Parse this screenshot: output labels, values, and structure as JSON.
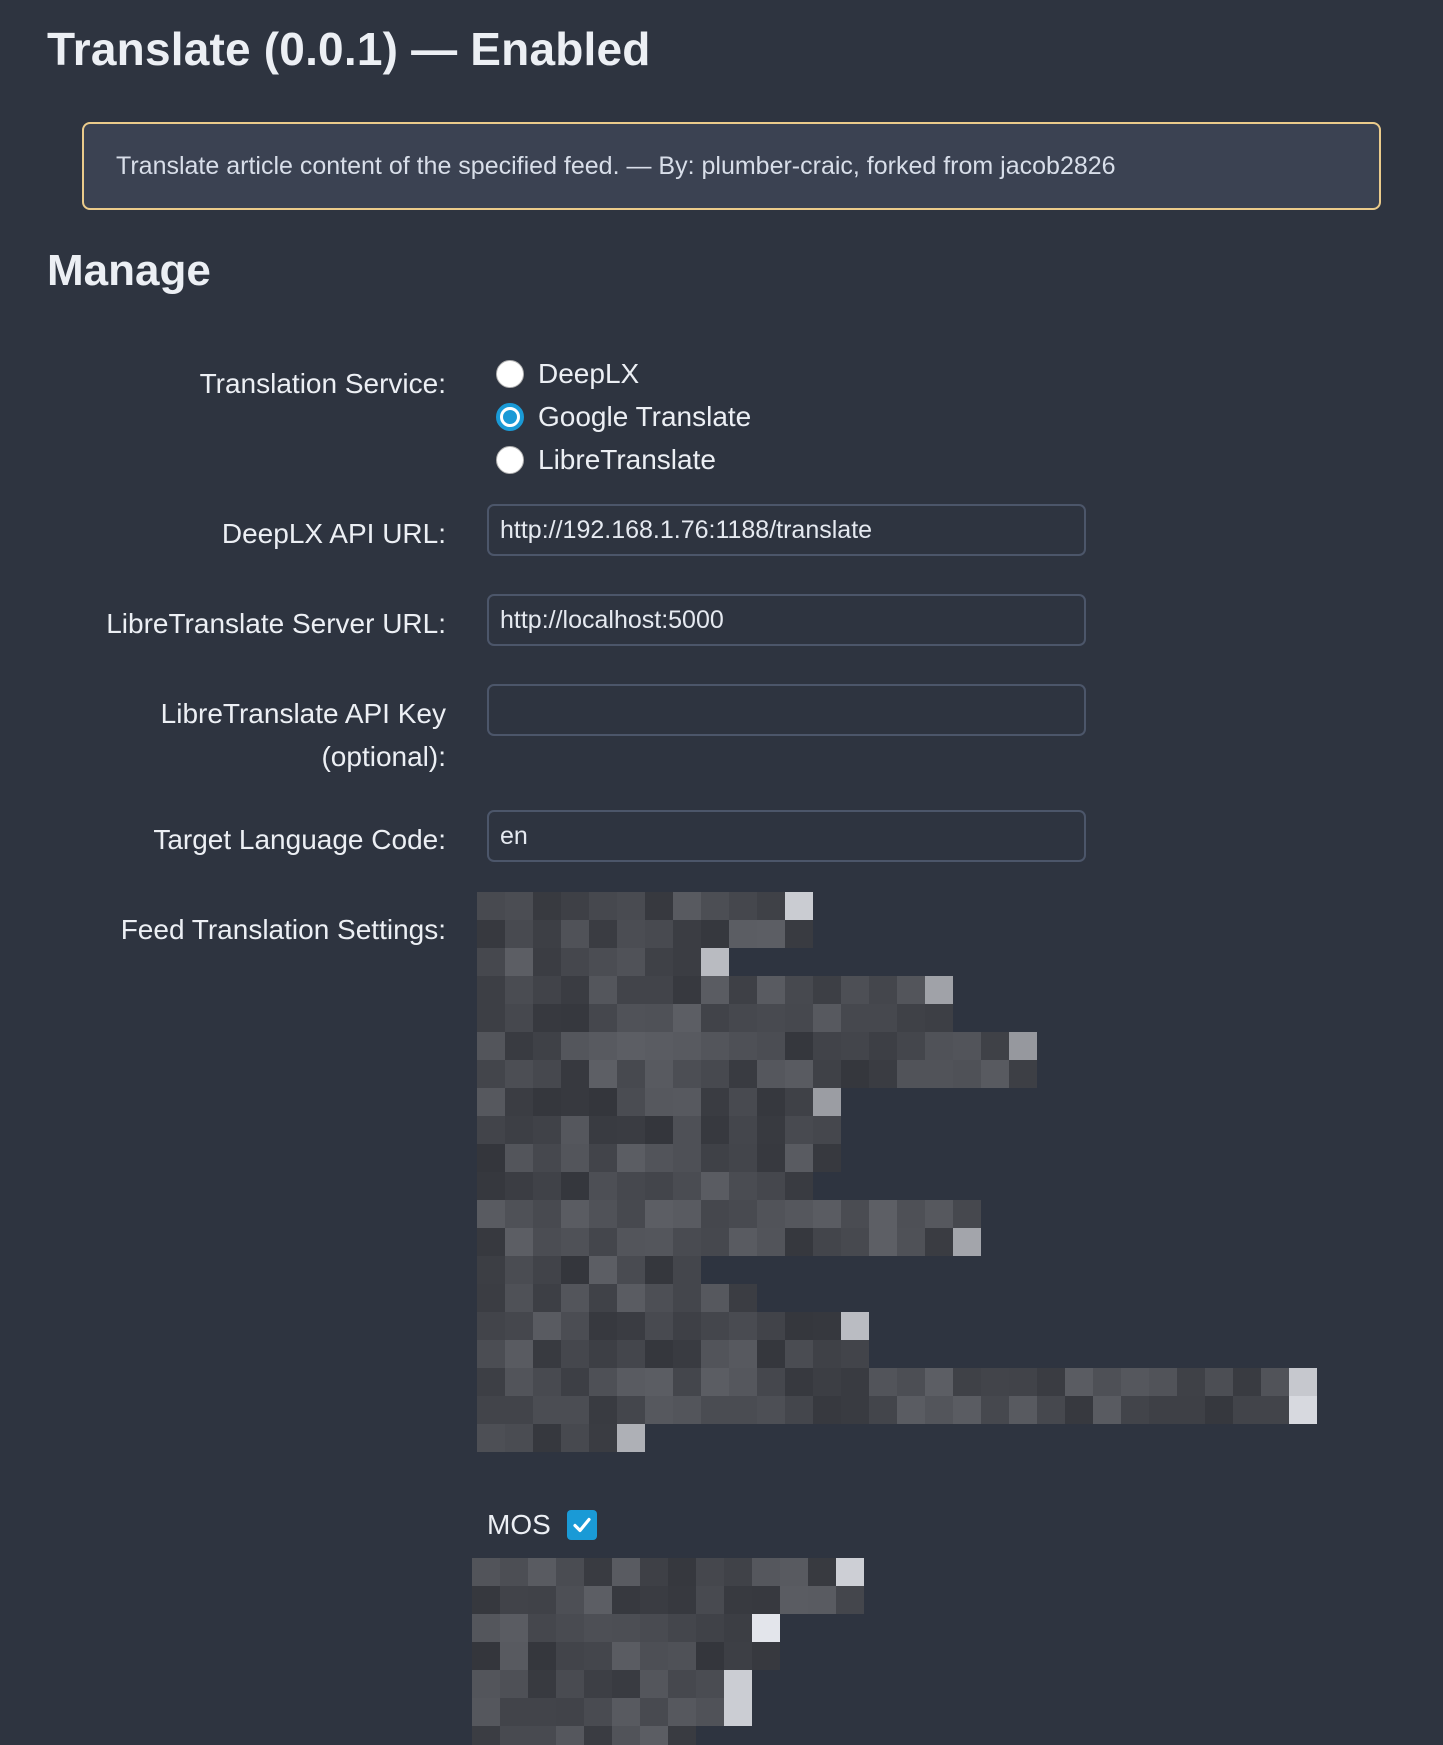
{
  "plugin": {
    "title": "Translate (0.0.1) — Enabled",
    "description": "Translate article content of the specified feed. — By: plumber-craic, forked from jacob2826"
  },
  "manage": {
    "heading": "Manage",
    "translation_service": {
      "label": "Translation Service:",
      "options": [
        "DeepLX",
        "Google Translate",
        "LibreTranslate"
      ],
      "selected": "Google Translate"
    },
    "deeplx_api_url": {
      "label": "DeepLX API URL:",
      "value": "http://192.168.1.76:1188/translate"
    },
    "libretranslate_server_url": {
      "label": "LibreTranslate Server URL:",
      "value": "http://localhost:5000"
    },
    "libretranslate_api_key": {
      "label_line1": "LibreTranslate API Key",
      "label_line2": "(optional):",
      "value": ""
    },
    "target_language_code": {
      "label": "Target Language Code:",
      "value": "en"
    },
    "feed_translation_settings": {
      "label": "Feed Translation Settings:",
      "feeds": [
        {
          "name": "MOS",
          "checked": true
        }
      ]
    }
  },
  "colors": {
    "background": "#2e3440",
    "notice_border": "#ebcb8b",
    "accent": "#1a9ad6"
  }
}
